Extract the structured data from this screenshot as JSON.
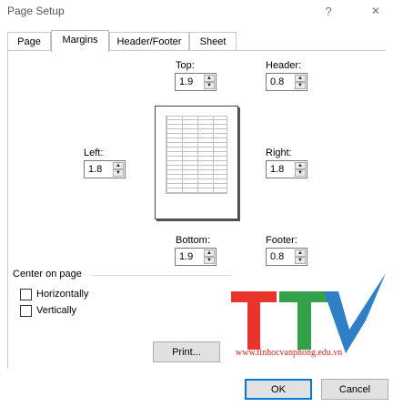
{
  "window": {
    "title": "Page Setup",
    "help_glyph": "?",
    "close_glyph": "✕"
  },
  "tabs": [
    {
      "label": "Page"
    },
    {
      "label": "Margins"
    },
    {
      "label": "Header/Footer"
    },
    {
      "label": "Sheet"
    }
  ],
  "margins": {
    "top": {
      "label": "Top:",
      "value": "1.9"
    },
    "header": {
      "label": "Header:",
      "value": "0.8"
    },
    "left": {
      "label": "Left:",
      "value": "1.8"
    },
    "right": {
      "label": "Right:",
      "value": "1.8"
    },
    "bottom": {
      "label": "Bottom:",
      "value": "1.9"
    },
    "footer": {
      "label": "Footer:",
      "value": "0.8"
    }
  },
  "center_on_page": {
    "title": "Center on page",
    "horizontally": {
      "label": "Horizontally",
      "checked": false
    },
    "vertically": {
      "label": "Vertically",
      "checked": false
    }
  },
  "buttons": {
    "print": "Print...",
    "ok": "OK",
    "cancel": "Cancel"
  },
  "watermark": {
    "logo": "TTV",
    "url": "www.tinhocvanphong.edu.vn",
    "colors": {
      "red": "#e8342a",
      "green": "#33a04a",
      "blue": "#2f7fc7"
    }
  }
}
